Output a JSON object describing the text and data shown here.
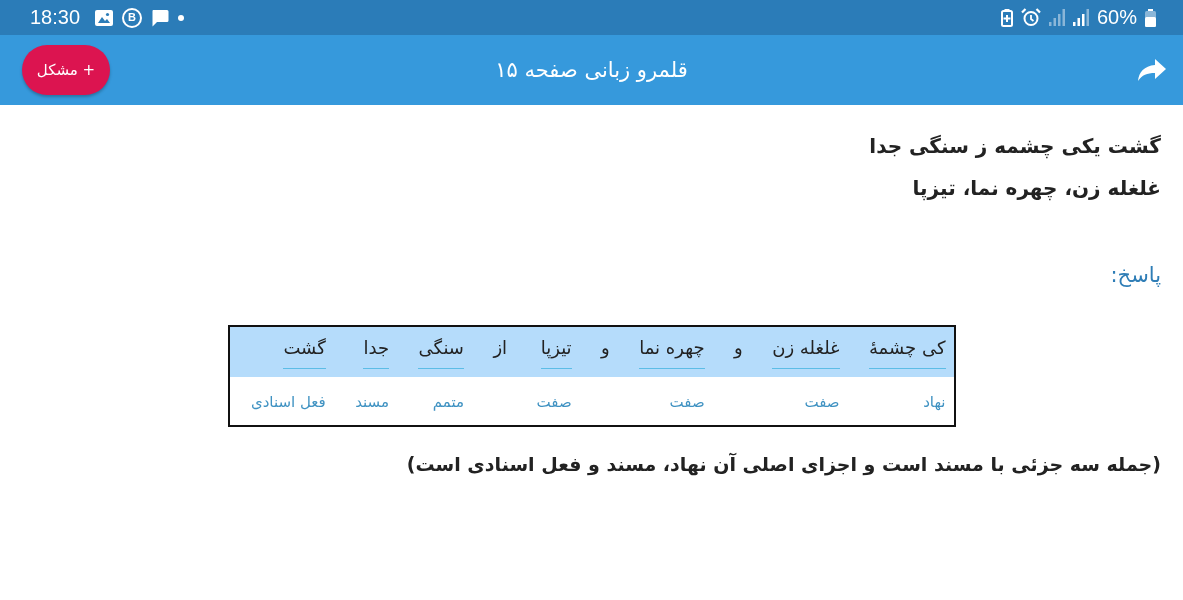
{
  "status_bar": {
    "time": "18:30",
    "notification_letter": "B",
    "battery_text": "60%"
  },
  "header": {
    "title": "قلمرو زبانی صفحه ۱۵",
    "report_button": "+ مشکل"
  },
  "content": {
    "poem_lines": [
      "گشت یکی چشمه ز سنگی جدا",
      "غلغله زن، چهره نما، تیزپا"
    ],
    "answer_label": "پاسخ:",
    "analysis_table": {
      "columns": [
        {
          "word": "کی چشمهٔ",
          "role": "نهاد",
          "underlined": true
        },
        {
          "word": "غلغله زن",
          "role": "صفت",
          "underlined": true
        },
        {
          "word": "و",
          "underlined": false
        },
        {
          "word": "چهره نما",
          "role": "صفت",
          "underlined": true
        },
        {
          "word": "و",
          "underlined": false
        },
        {
          "word": "تیزپا",
          "role": "صفت",
          "underlined": true
        },
        {
          "word": "از",
          "underlined": false
        },
        {
          "word": "سنگی",
          "role": "متمم",
          "underlined": true
        },
        {
          "word": "جدا",
          "role": "مسند",
          "underlined": true
        },
        {
          "word": "گشت",
          "role": "فعل اسنادی",
          "underlined": true
        }
      ]
    },
    "note": "(جمله سه جزئی با مسند است و اجزای اصلی آن نهاد، مسند و فعل اسنادی است)"
  }
}
